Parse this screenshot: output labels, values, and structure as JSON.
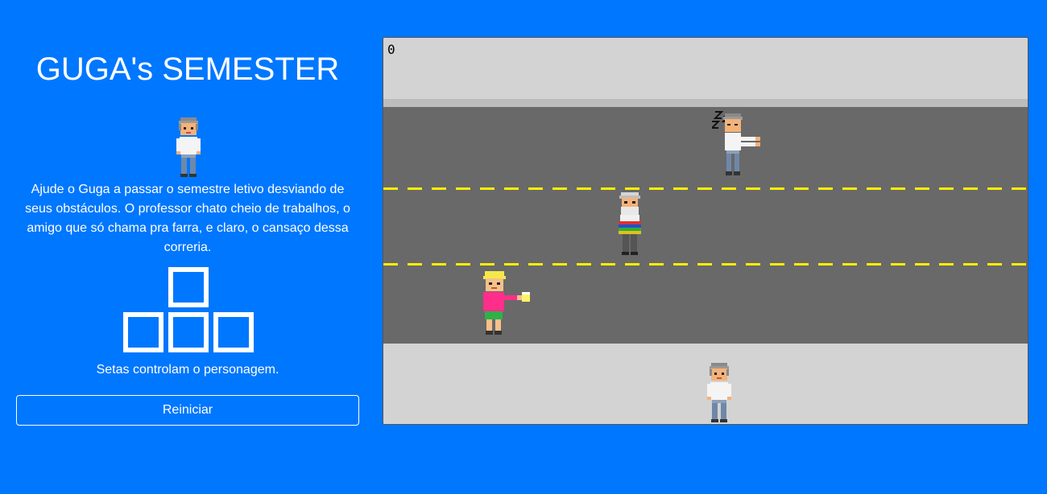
{
  "sidebar": {
    "title": "GUGA's SEMESTER",
    "description": "Ajude o Guga a passar o semestre letivo desviando de seus obstáculos. O professor chato cheio de trabalhos, o amigo que só chama pra farra, e claro, o cansaço dessa correria.",
    "controls_hint": "Setas controlam o personagem.",
    "restart_label": "Reiniciar",
    "keys": [
      "arrow-up-key",
      "arrow-left-key",
      "arrow-down-key",
      "arrow-right-key"
    ]
  },
  "game": {
    "score": "0",
    "lane_line_color": "#ffee00",
    "road_color": "#696969",
    "sidewalk_color": "#d3d3d3",
    "obstacles": [
      "sleepy-zombie-obstacle",
      "professor-obstacle",
      "party-friend-obstacle"
    ],
    "player": "guga-player"
  },
  "colors": {
    "background": "#0077ff",
    "text": "#ffffff"
  }
}
